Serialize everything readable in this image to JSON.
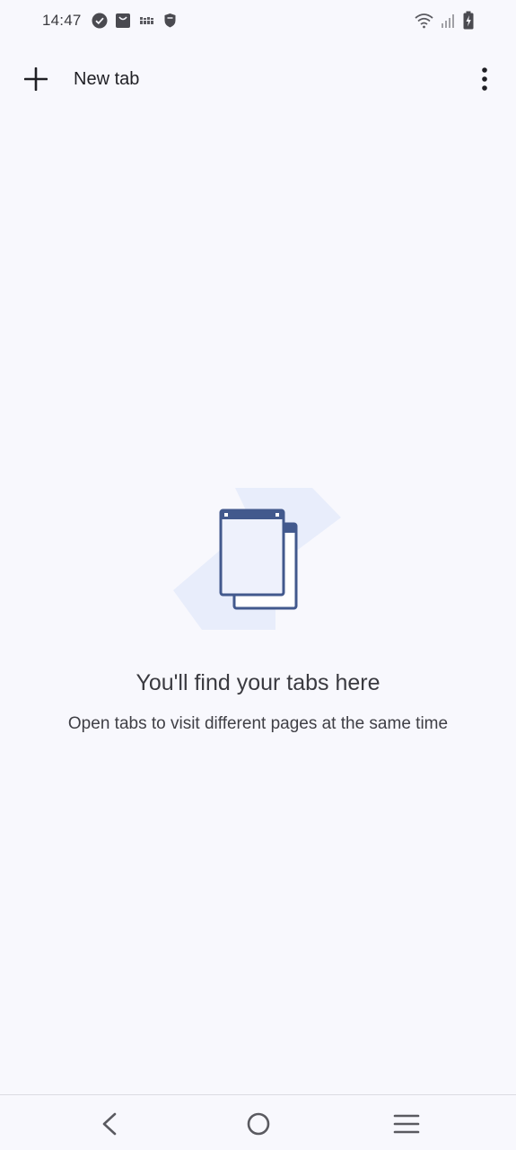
{
  "status_bar": {
    "time": "14:47",
    "left_icons": [
      "check-circle-icon",
      "bag-icon",
      "text-badge-icon",
      "shield-icon"
    ],
    "right_icons": [
      "wifi-icon",
      "signal-icon",
      "battery-charging-icon"
    ]
  },
  "toolbar": {
    "new_tab_label": "New tab",
    "new_tab_icon": "plus-icon",
    "menu_icon": "more-vertical-icon"
  },
  "empty_state": {
    "title": "You'll find your tabs here",
    "subtitle": "Open tabs to visit different pages at the same time",
    "illustration": "tabs-illustration"
  },
  "nav_bar": {
    "back_icon": "back-icon",
    "home_icon": "home-icon",
    "recents_icon": "recents-icon"
  },
  "colors": {
    "background": "#f8f8fd",
    "illustration_primary": "#42598d",
    "illustration_light": "#e8edfb",
    "text_primary": "#1f1f24"
  }
}
